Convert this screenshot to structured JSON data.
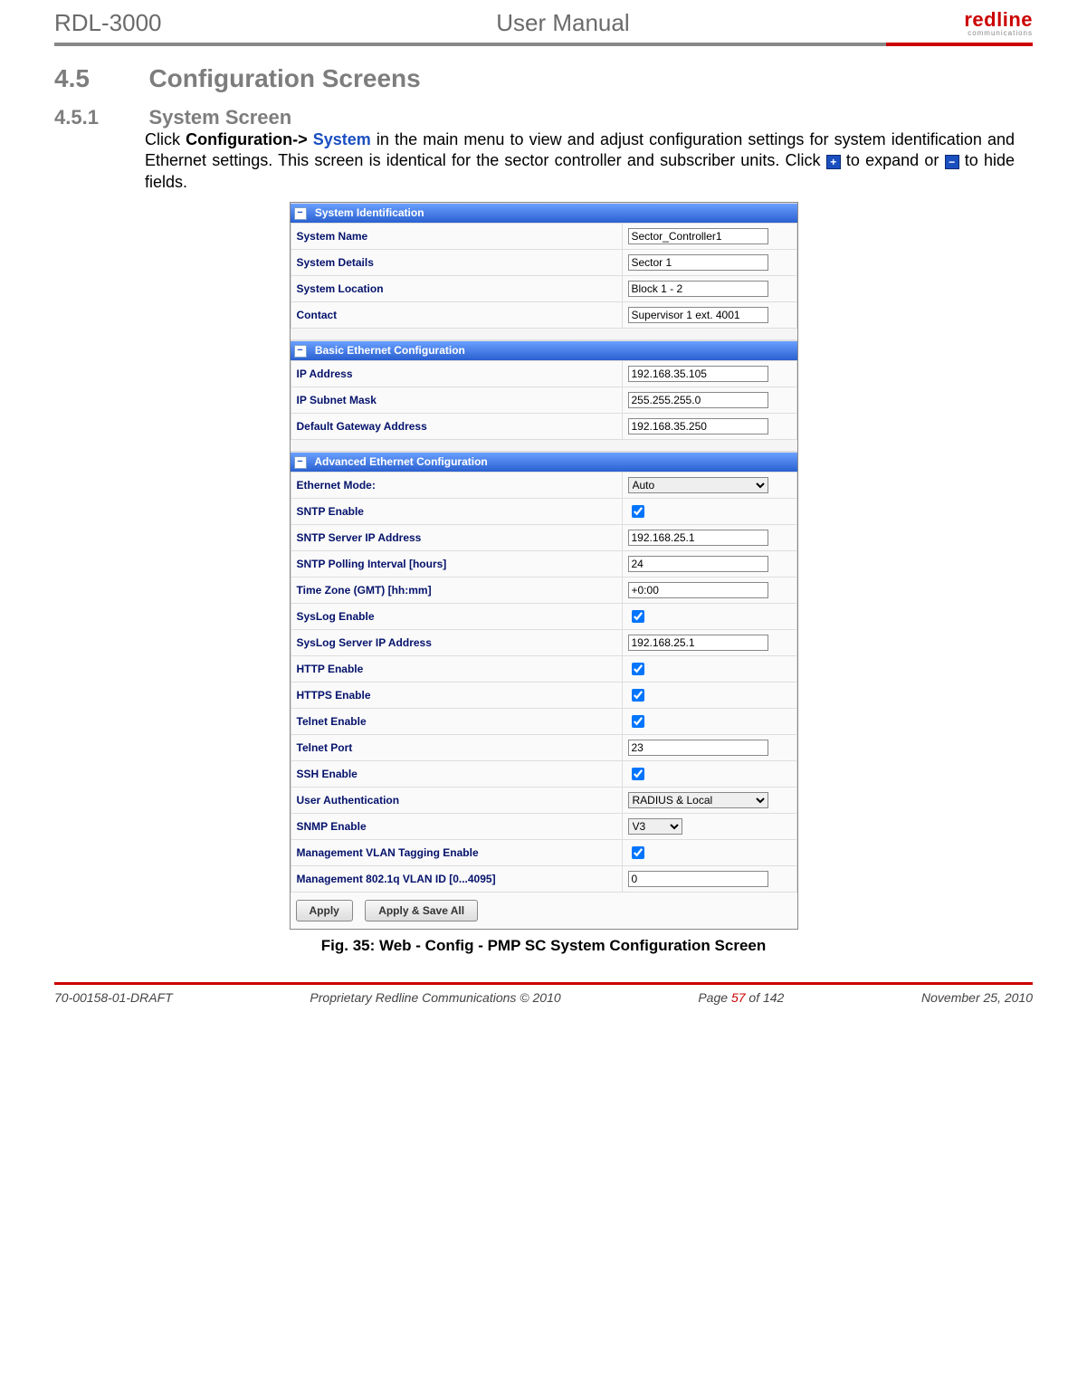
{
  "header": {
    "left": "RDL-3000",
    "center": "User Manual",
    "logo_main": "redline",
    "logo_sub": "communications"
  },
  "section": {
    "num": "4.5",
    "title": "Configuration Screens"
  },
  "subsection": {
    "num": "4.5.1",
    "title": "System Screen"
  },
  "body": {
    "p1a": "Click ",
    "p1b": "Configuration->",
    "p1c": " System",
    "p1d": " in the main menu to view and adjust configuration settings for system identification and Ethernet settings. This screen is identical for the sector controller and subscriber units. Click ",
    "p1e": " to expand or ",
    "p1f": " to hide fields."
  },
  "screenshot": {
    "bands": {
      "sysid": "System Identification",
      "basic": "Basic Ethernet Configuration",
      "advanced": "Advanced Ethernet Configuration"
    },
    "fields": {
      "system_name_label": "System Name",
      "system_name_value": "Sector_Controller1",
      "system_details_label": "System Details",
      "system_details_value": "Sector 1",
      "system_location_label": "System Location",
      "system_location_value": "Block 1 - 2",
      "contact_label": "Contact",
      "contact_value": "Supervisor 1 ext. 4001",
      "ip_label": "IP Address",
      "ip_value": "192.168.35.105",
      "mask_label": "IP Subnet Mask",
      "mask_value": "255.255.255.0",
      "gw_label": "Default Gateway Address",
      "gw_value": "192.168.35.250",
      "eth_mode_label": "Ethernet Mode:",
      "eth_mode_value": "Auto",
      "sntp_enable_label": "SNTP Enable",
      "sntp_ip_label": "SNTP Server IP Address",
      "sntp_ip_value": "192.168.25.1",
      "sntp_poll_label": "SNTP Polling Interval [hours]",
      "sntp_poll_value": "24",
      "tz_label": "Time Zone (GMT) [hh:mm]",
      "tz_value": "+0:00",
      "syslog_enable_label": "SysLog Enable",
      "syslog_ip_label": "SysLog Server IP Address",
      "syslog_ip_value": "192.168.25.1",
      "http_label": "HTTP Enable",
      "https_label": "HTTPS Enable",
      "telnet_label": "Telnet Enable",
      "telnet_port_label": "Telnet Port",
      "telnet_port_value": "23",
      "ssh_label": "SSH Enable",
      "auth_label": "User Authentication",
      "auth_value": "RADIUS & Local",
      "snmp_label": "SNMP Enable",
      "snmp_value": "V3",
      "vlan_tag_label": "Management VLAN Tagging Enable",
      "vlan_id_label": "Management 802.1q VLAN ID [0...4095]",
      "vlan_id_value": "0",
      "btn_apply": "Apply",
      "btn_apply_save": "Apply & Save All"
    }
  },
  "caption": "Fig. 35: Web - Config - PMP SC System Configuration Screen",
  "footer": {
    "doc": "70-00158-01-DRAFT",
    "copy": "Proprietary Redline Communications © 2010",
    "page_a": "Page ",
    "page_n": "57",
    "page_b": " of 142",
    "date": "November 25, 2010"
  }
}
